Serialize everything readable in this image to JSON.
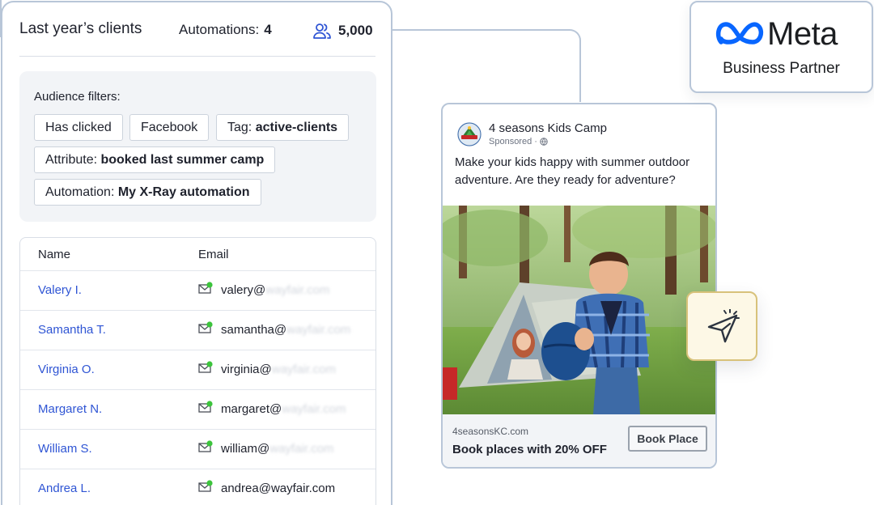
{
  "clients_panel": {
    "title": "Last year’s clients",
    "automations_label": "Automations:",
    "automations_count": "4",
    "audience_size": "5,000",
    "filters": {
      "label": "Audience filters:",
      "chips": [
        {
          "prefix": "Has clicked",
          "value": ""
        },
        {
          "prefix": "Facebook",
          "value": ""
        },
        {
          "prefix": "Tag: ",
          "value": "active-clients"
        },
        {
          "prefix": "Attribute: ",
          "value": "booked last summer camp"
        },
        {
          "prefix": "Automation: ",
          "value": "My X-Ray automation"
        }
      ]
    },
    "table": {
      "headers": [
        "Name",
        "Email"
      ],
      "rows": [
        {
          "name": "Valery I.",
          "email_user": "valery@",
          "email_domain": "wayfair.com"
        },
        {
          "name": "Samantha T.",
          "email_user": "samantha@",
          "email_domain": "wayfair.com"
        },
        {
          "name": "Virginia O.",
          "email_user": "virginia@",
          "email_domain": "wayfair.com"
        },
        {
          "name": "Margaret N.",
          "email_user": "margaret@",
          "email_domain": "wayfair.com"
        },
        {
          "name": "William S.",
          "email_user": "william@",
          "email_domain": "wayfair.com"
        },
        {
          "name": "Andrea L.",
          "email_user": "andrea@",
          "email_domain": "wayfair.com"
        }
      ],
      "online_status_color": "#3cc43c"
    }
  },
  "ad": {
    "page_name": "4 seasons Kids Camp",
    "sponsored": "Sponsored ·",
    "text": "Make your kids happy with summer outdoor adventure. Are they ready for adventure?",
    "domain": "4seasonsKC.com",
    "headline": "Book places with 20% OFF",
    "cta": "Book Place"
  },
  "meta_badge": {
    "wordmark": "Meta",
    "subtitle": "Business Partner",
    "logo_color": "#0866ff"
  },
  "accent_color": "#2f55d4"
}
